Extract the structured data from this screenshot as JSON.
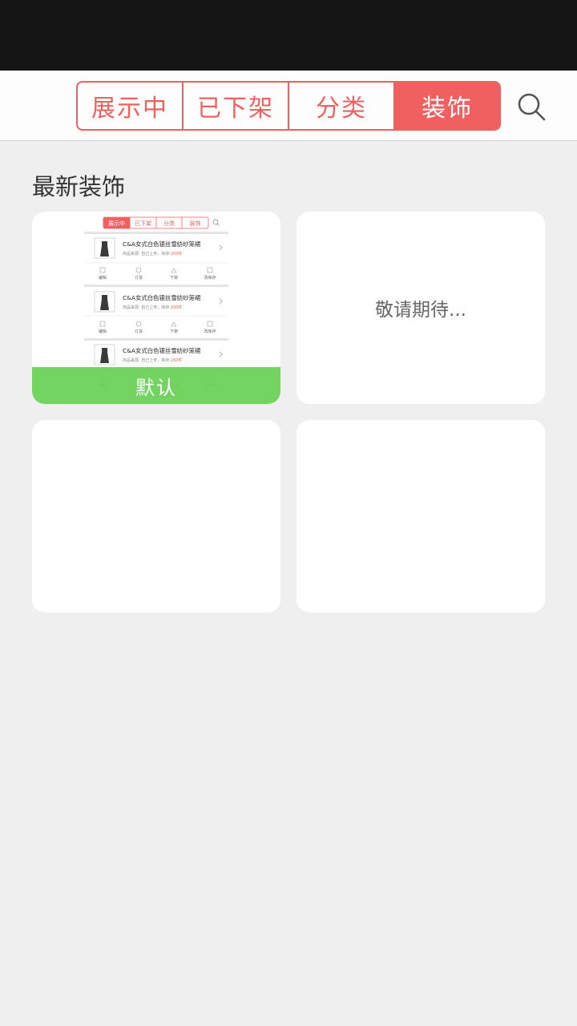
{
  "tabs": [
    {
      "label": "展示中",
      "active": false
    },
    {
      "label": "已下架",
      "active": false
    },
    {
      "label": "分类",
      "active": false
    },
    {
      "label": "装饰",
      "active": true
    }
  ],
  "accent_color": "#f06060",
  "default_badge_color": "#6cd258",
  "section_title": "最新装饰",
  "cards": [
    {
      "type": "template-preview",
      "badge": "默认",
      "preview": {
        "tabs": [
          "展示中",
          "已下架",
          "分类",
          "装饰"
        ],
        "items": [
          {
            "title": "C&A女式白色银丝雪纺纱笼裙",
            "meta": "商品来源: 自己上传，库存:",
            "stock": "200件"
          },
          {
            "title": "C&A女式白色银丝雪纺纱笼裙",
            "meta": "商品来源: 自己上传，库存:",
            "stock": "200件"
          },
          {
            "title": "C&A女式白色银丝雪纺纱笼裙",
            "meta": "商品来源: 自己上传，库存:",
            "stock": "200件"
          }
        ],
        "actions": [
          "编辑",
          "订货",
          "下架",
          "改库存"
        ]
      }
    },
    {
      "type": "placeholder",
      "text": "敬请期待..."
    },
    {
      "type": "empty"
    },
    {
      "type": "empty"
    }
  ]
}
